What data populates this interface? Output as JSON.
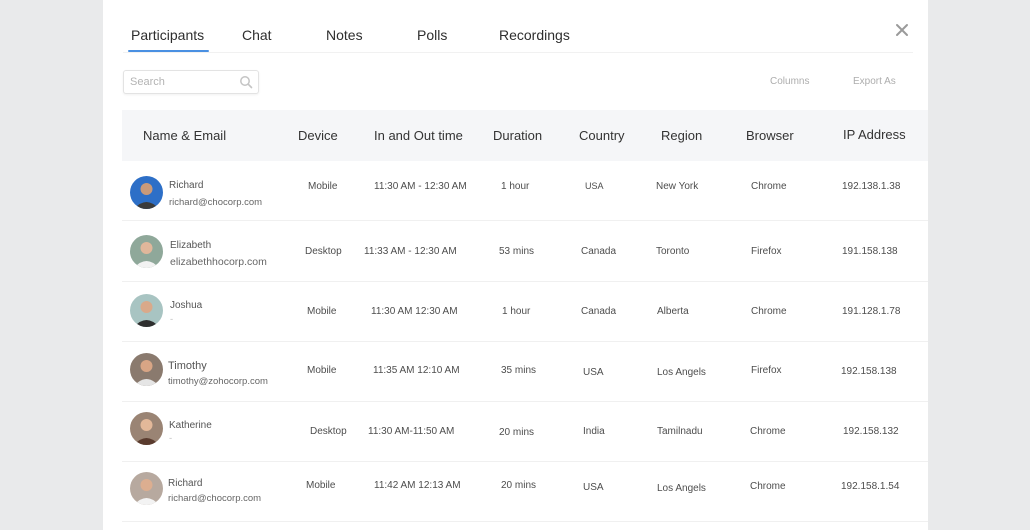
{
  "tabs": [
    "Participants",
    "Chat",
    "Notes",
    "Polls",
    "Recordings"
  ],
  "active_tab": "Participants",
  "search": {
    "placeholder": "Search"
  },
  "toolbar": {
    "columns_label": "Columns",
    "export_label": "Export As"
  },
  "table": {
    "headers": [
      "Name & Email",
      "Device",
      "In and Out time",
      "Duration",
      "Country",
      "Region",
      "Browser",
      "IP Address"
    ],
    "rows": [
      {
        "name": "Richard",
        "email": "richard@chocorp.com",
        "device": "Mobile",
        "time": "11:30 AM - 12:30 AM",
        "duration": "1 hour",
        "country": "USA",
        "region": "New York",
        "browser": "Chrome",
        "ip": "192.138.1.38",
        "avatar_color": "#2d6fc7"
      },
      {
        "name": "Elizabeth",
        "email": "elizabethhocorp.com",
        "device": "Desktop",
        "time": "11:33 AM - 12:30 AM",
        "duration": "53 mins",
        "country": "Canada",
        "region": "Toronto",
        "browser": "Firefox",
        "ip": "191.158.138",
        "avatar_color": "#8fa89a"
      },
      {
        "name": "Joshua",
        "email": "-",
        "device": "Mobile",
        "time": "11:30 AM 12:30 AM",
        "duration": "1 hour",
        "country": "Canada",
        "region": "Alberta",
        "browser": "Chrome",
        "ip": "191.128.1.78",
        "avatar_color": "#a8c4c2"
      },
      {
        "name": "Timothy",
        "email": "timothy@zohocorp.com",
        "device": "Mobile",
        "time": "11:35 AM 12:10 AM",
        "duration": "35 mins",
        "country": "USA",
        "region": "Los Angels",
        "browser": "Firefox",
        "ip": "192.158.138",
        "avatar_color": "#8a7a6e"
      },
      {
        "name": "Katherine",
        "email": "-",
        "device": "Desktop",
        "time": "11:30 AM-11:50 AM",
        "duration": "20 mins",
        "country": "India",
        "region": "Tamilnadu",
        "browser": "Chrome",
        "ip": "192.158.132",
        "avatar_color": "#9a8474"
      },
      {
        "name": "Richard",
        "email": "richard@chocorp.com",
        "device": "Mobile",
        "time": "11:42 AM 12:13 AM",
        "duration": "20 mins",
        "country": "USA",
        "region": "Los Angels",
        "browser": "Chrome",
        "ip": "192.158.1.54",
        "avatar_color": "#b7a99f"
      }
    ]
  }
}
